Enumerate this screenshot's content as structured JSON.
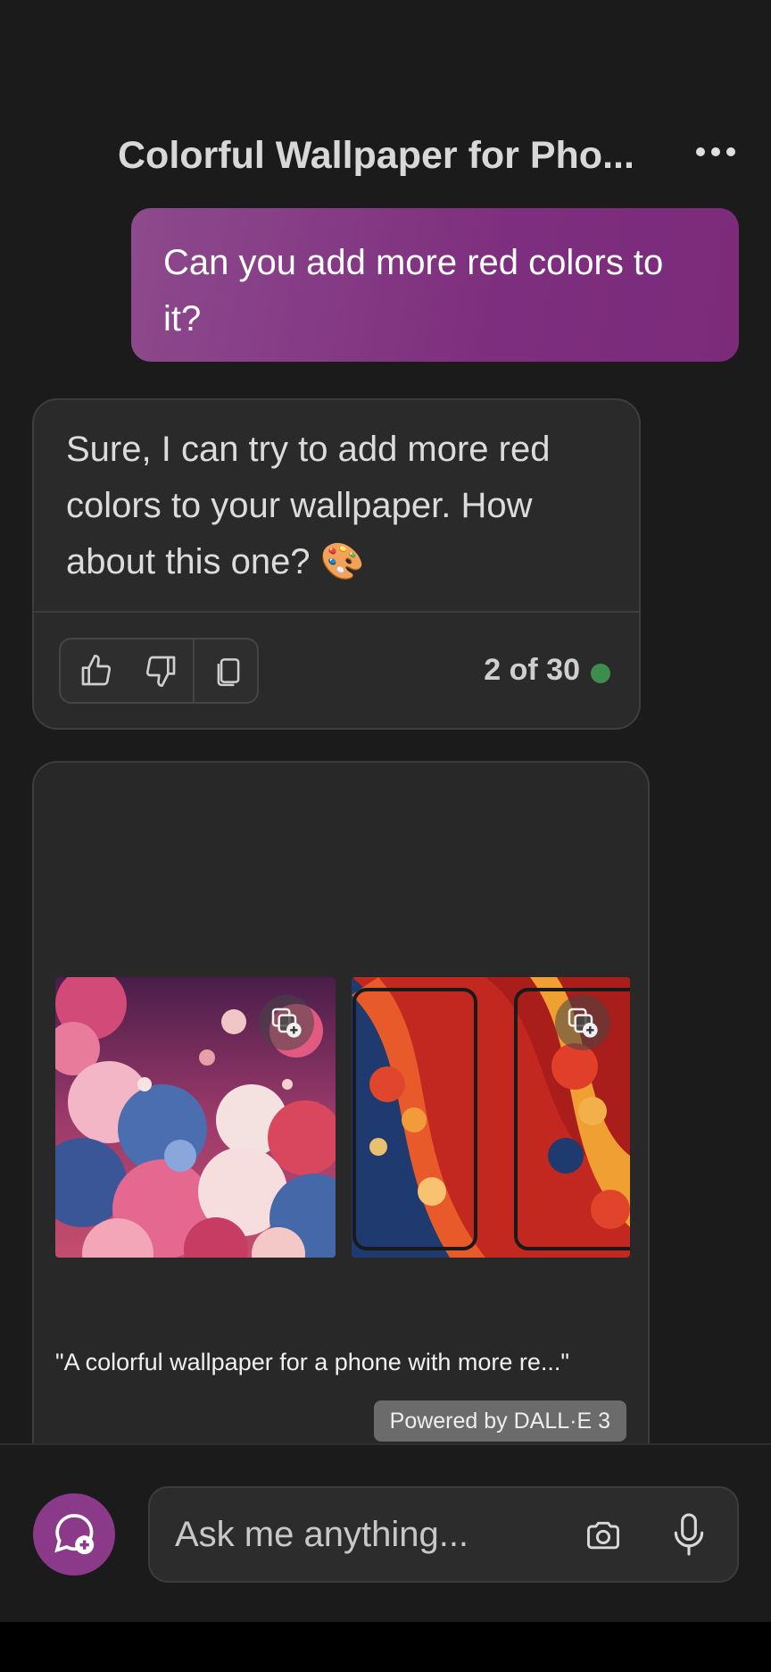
{
  "header": {
    "title": "Colorful Wallpaper for Pho..."
  },
  "conversation": {
    "user_message": "Can you add more red colors to it?",
    "bot_message": "Sure, I can try to add more red colors to your wallpaper. How about this one? 🎨",
    "response_counter": "2 of 30",
    "status_color": "#3f8d4c"
  },
  "image_result": {
    "caption": "\"A colorful wallpaper for a phone with more re...\"",
    "powered_by": "Powered by DALL·E 3",
    "images": [
      {
        "name": "generated-image-1"
      },
      {
        "name": "generated-image-2"
      }
    ]
  },
  "composer": {
    "placeholder": "Ask me anything..."
  },
  "icons": [
    "more-options-icon",
    "thumbs-up-icon",
    "thumbs-down-icon",
    "copy-icon",
    "save-to-collection-icon",
    "new-chat-icon",
    "camera-icon",
    "microphone-icon"
  ],
  "colors": {
    "accent": "#8a3a88",
    "user_bubble": "#7e2e7e",
    "background": "#1b1b1b",
    "card": "#2a2a2a"
  }
}
